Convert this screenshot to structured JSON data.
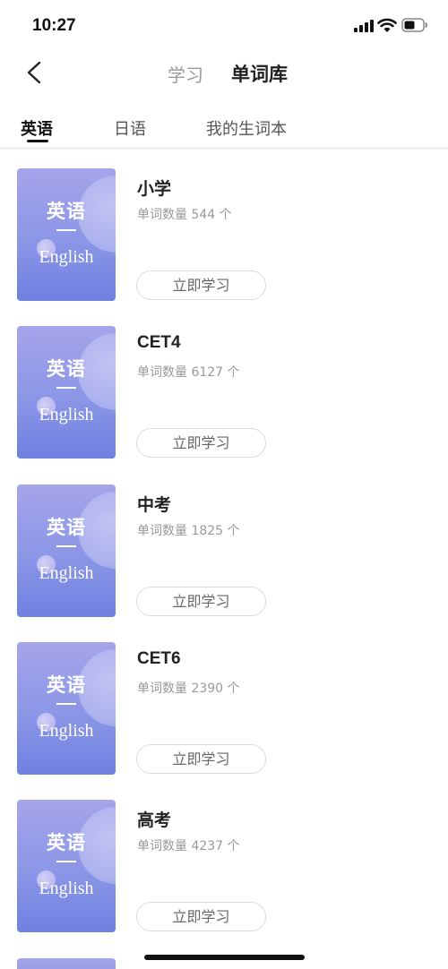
{
  "status_bar": {
    "time": "10:27"
  },
  "nav": {
    "tab_study": "学习",
    "tab_library": "单词库"
  },
  "categories": [
    {
      "label": "英语",
      "active": true
    },
    {
      "label": "日语",
      "active": false
    },
    {
      "label": "我的生词本",
      "active": false
    }
  ],
  "cover": {
    "cn": "英语",
    "en": "English"
  },
  "books": [
    {
      "title": "小学",
      "count": "单词数量 544 个",
      "button": "立即学习"
    },
    {
      "title": "CET4",
      "count": "单词数量 6127 个",
      "button": "立即学习"
    },
    {
      "title": "中考",
      "count": "单词数量 1825 个",
      "button": "立即学习"
    },
    {
      "title": "CET6",
      "count": "单词数量 2390 个",
      "button": "立即学习"
    },
    {
      "title": "高考",
      "count": "单词数量 4237 个",
      "button": "立即学习"
    }
  ],
  "colors": {
    "cover_top": "#a6a4ea",
    "cover_bottom": "#6f80e0",
    "text_primary": "#222222",
    "text_secondary": "#999999"
  },
  "icons": {
    "back": "chevron-left-icon",
    "signal": "cellular-signal-icon",
    "wifi": "wifi-icon",
    "battery": "battery-icon"
  }
}
